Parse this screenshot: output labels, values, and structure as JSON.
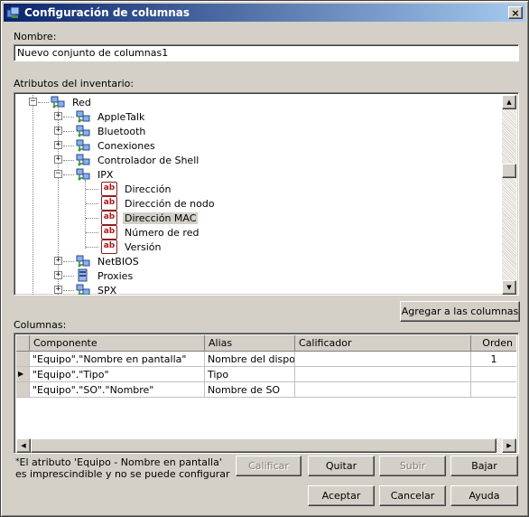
{
  "window": {
    "title": "Configuración de columnas",
    "close_label": "×"
  },
  "name_field": {
    "label": "Nombre:",
    "value": "Nuevo conjunto de columnas1"
  },
  "tree": {
    "label": "Atributos del inventario:",
    "nodes": [
      {
        "label": "Red"
      },
      {
        "label": "AppleTalk"
      },
      {
        "label": "Bluetooth"
      },
      {
        "label": "Conexiones"
      },
      {
        "label": "Controlador de Shell"
      },
      {
        "label": "IPX"
      },
      {
        "label": "Dirección"
      },
      {
        "label": "Dirección de nodo"
      },
      {
        "label": "Dirección MAC"
      },
      {
        "label": "Número de red"
      },
      {
        "label": "Versión"
      },
      {
        "label": "NetBIOS"
      },
      {
        "label": "Proxies"
      },
      {
        "label": "SPX"
      }
    ],
    "expander_plus": "+",
    "expander_minus": "−",
    "attr_icon_text": "ab"
  },
  "add_button": "Agregar a las columnas",
  "columns": {
    "label": "Columnas:",
    "headers": [
      "Componente",
      "Alias",
      "Calificador",
      "Orden"
    ],
    "rows": [
      {
        "componente": "\"Equipo\".\"Nombre en pantalla\"",
        "alias": "Nombre del dispos",
        "calificador": "",
        "orden": "1"
      },
      {
        "componente": "\"Equipo\".\"Tipo\"",
        "alias": "Tipo",
        "calificador": "",
        "orden": ""
      },
      {
        "componente": "\"Equipo\".\"SO\".\"Nombre\"",
        "alias": "Nombre de SO",
        "calificador": "",
        "orden": ""
      }
    ],
    "row_indicator": "▶"
  },
  "note": "El atributo 'Equipo - Nombre en pantalla' es imprescindible y no se puede configurar",
  "note_marker": "*",
  "buttons": {
    "calificar": "Calificar",
    "quitar": "Quitar",
    "subir": "Subir",
    "bajar": "Bajar",
    "aceptar": "Aceptar",
    "cancelar": "Cancelar",
    "ayuda": "Ayuda"
  },
  "colors": {
    "title_start": "#0a246a",
    "title_end": "#a6caf0",
    "face": "#d4d0c8"
  }
}
